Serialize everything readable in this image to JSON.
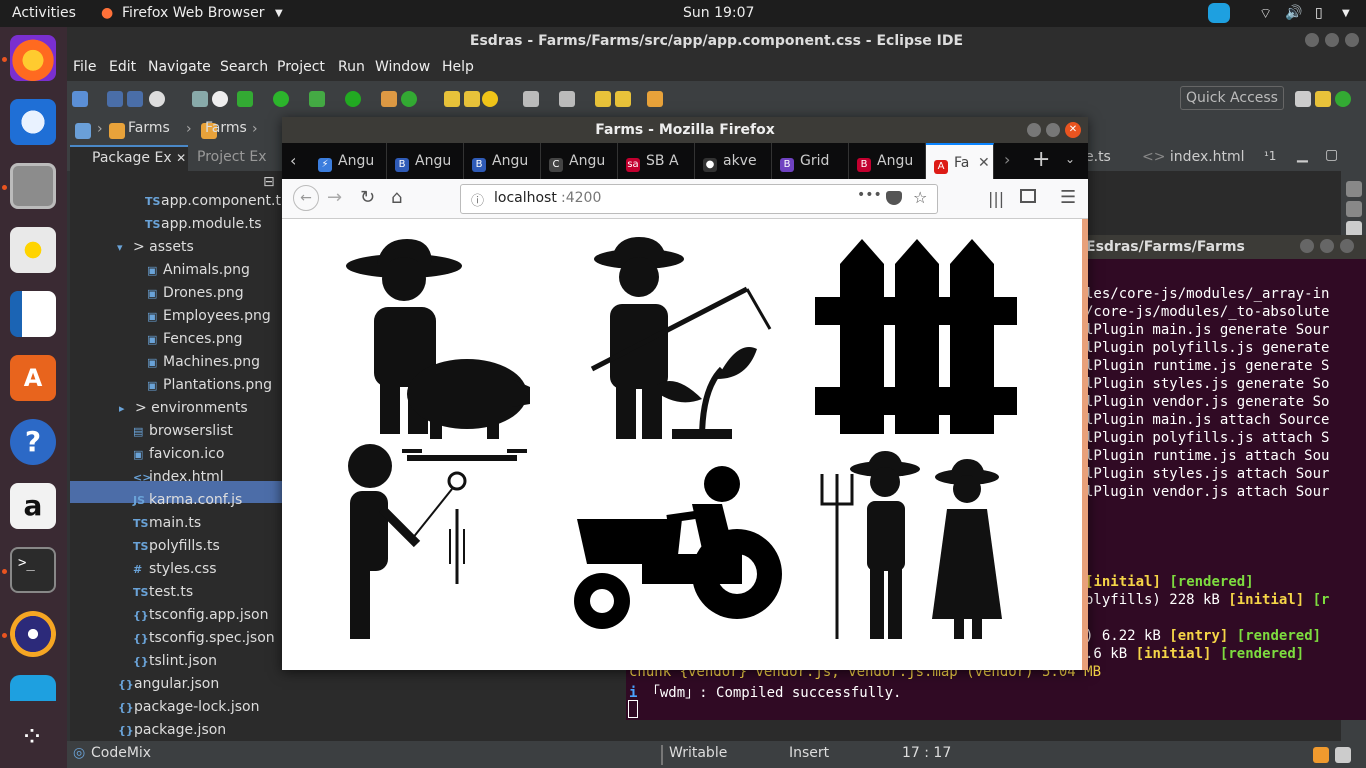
{
  "topbar": {
    "activities": "Activities",
    "app": "Firefox Web Browser",
    "clock": "Sun 19:07"
  },
  "eclipse": {
    "title": "Esdras - Farms/Farms/src/app/app.component.css - Eclipse IDE",
    "menu": [
      "File",
      "Edit",
      "Navigate",
      "Search",
      "Project",
      "Run",
      "Window",
      "Help"
    ],
    "quick_access": "Quick Access",
    "breadcrumb": [
      "Farms",
      "Farms"
    ],
    "tabs": {
      "package_explorer": "Package Ex",
      "project_explorer": "Project Ex",
      "ts_tab": "e.ts",
      "index_tab": "index.html",
      "more": "¹1"
    },
    "tree": [
      {
        "icon": "TS",
        "label": "app.component.t"
      },
      {
        "icon": "TS",
        "label": "app.module.ts"
      },
      {
        "icon": "▾",
        "label": "> assets"
      },
      {
        "icon": "▣",
        "label": "Animals.png"
      },
      {
        "icon": "▣",
        "label": "Drones.png"
      },
      {
        "icon": "▣",
        "label": "Employees.png"
      },
      {
        "icon": "▣",
        "label": "Fences.png"
      },
      {
        "icon": "▣",
        "label": "Machines.png"
      },
      {
        "icon": "▣",
        "label": "Plantations.png"
      },
      {
        "icon": "▸",
        "label": "> environments"
      },
      {
        "icon": "▤",
        "label": "browserslist"
      },
      {
        "icon": "▣",
        "label": "favicon.ico"
      },
      {
        "icon": "<>",
        "label": "index.html"
      },
      {
        "icon": "JS",
        "label": "karma.conf.js"
      },
      {
        "icon": "TS",
        "label": "main.ts"
      },
      {
        "icon": "TS",
        "label": "polyfills.ts"
      },
      {
        "icon": "#",
        "label": "styles.css"
      },
      {
        "icon": "TS",
        "label": "test.ts"
      },
      {
        "icon": "{}",
        "label": "tsconfig.app.json"
      },
      {
        "icon": "{}",
        "label": "tsconfig.spec.json"
      },
      {
        "icon": "{}",
        "label": "tslint.json"
      },
      {
        "icon": "{}",
        "label": "angular.json"
      },
      {
        "icon": "{}",
        "label": "package-lock.json"
      },
      {
        "icon": "{}",
        "label": "package.json"
      }
    ],
    "status": {
      "codemix": "CodeMix",
      "writable": "Writable",
      "insert": "Insert",
      "position": "17 : 17"
    }
  },
  "terminal": {
    "title": "Esdras/Farms/Farms",
    "lines": [
      "les/core-js/modules/_array-in",
      "/core-js/modules/_to-absolute",
      "lPlugin main.js generate Sour",
      "lPlugin polyfills.js generate",
      "lPlugin runtime.js generate S",
      "lPlugin styles.js generate So",
      "lPlugin vendor.js generate So",
      "lPlugin main.js attach Source",
      "lPlugin polyfills.js attach S",
      "lPlugin runtime.js attach Sou",
      "lPlugin styles.js attach Sour",
      "lPlugin vendor.js attach Sour"
    ],
    "initial": "initial",
    "rendered": "rendered",
    "polyfills": "olyfills) 228 kB",
    "entry_prefix": ") 6.22 kB",
    "entry": "entry",
    "main_prefix": ".6 kB",
    "chunk_line": "chunk {vendor} vendor.js, vendor.js.map (vendor) 5.04 MB",
    "compiled": "「wdm」: Compiled successfully."
  },
  "firefox": {
    "title": "Farms - Mozilla Firefox",
    "tabs": [
      {
        "label": "Angu",
        "icon": "⚡",
        "color": "#3b7ddd"
      },
      {
        "label": "Angu",
        "icon": "B",
        "color": "#2f5bb7"
      },
      {
        "label": "Angu",
        "icon": "B",
        "color": "#2f5bb7"
      },
      {
        "label": "Angu",
        "icon": "C",
        "color": "#444"
      },
      {
        "label": "SB A",
        "icon": "sa",
        "color": "#c3002f"
      },
      {
        "label": "akve",
        "icon": "●",
        "color": "#333"
      },
      {
        "label": "Grid",
        "icon": "B",
        "color": "#6f42c1"
      },
      {
        "label": "Angu",
        "icon": "B",
        "color": "#c3002f"
      },
      {
        "label": "Fa",
        "icon": "A",
        "color": "#dd1b16"
      }
    ],
    "url_host": "localhost",
    "url_port": ":4200",
    "images": [
      "Animals",
      "Plantations",
      "Fences",
      "Drones",
      "Machines",
      "Employees"
    ]
  }
}
